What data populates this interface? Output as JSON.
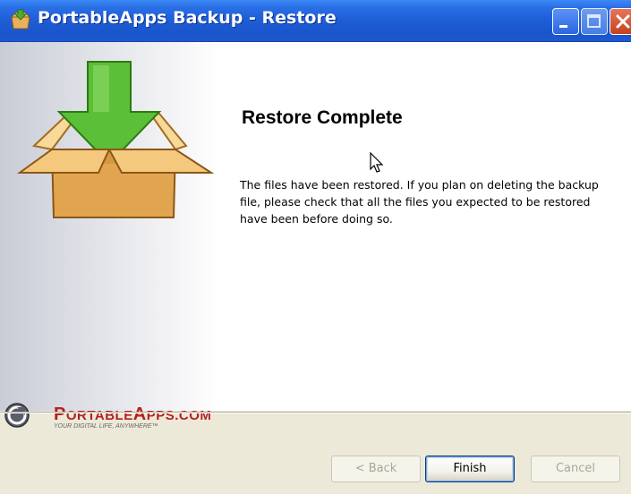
{
  "window": {
    "title": "PortableApps Backup - Restore",
    "icons": {
      "app": "package-icon",
      "minimize": "minimize-icon",
      "maximize": "maximize-icon",
      "close": "close-icon"
    }
  },
  "page": {
    "heading": "Restore Complete",
    "message": "The files have been restored.  If you plan on deleting the backup file, please check that all the files you expected to be restored have been before doing so."
  },
  "branding": {
    "name_prefix": "P",
    "name_mid": "ORTABLE",
    "name_a": "A",
    "name_rest": "PPS.COM",
    "tagline": "YOUR DIGITAL LIFE, ANYWHERE™"
  },
  "buttons": {
    "back": "< Back",
    "finish": "Finish",
    "cancel": "Cancel"
  },
  "colors": {
    "titlebar": "#1f5fd8",
    "brand_red": "#b51f1f",
    "dialog_bg": "#ece9d8"
  }
}
